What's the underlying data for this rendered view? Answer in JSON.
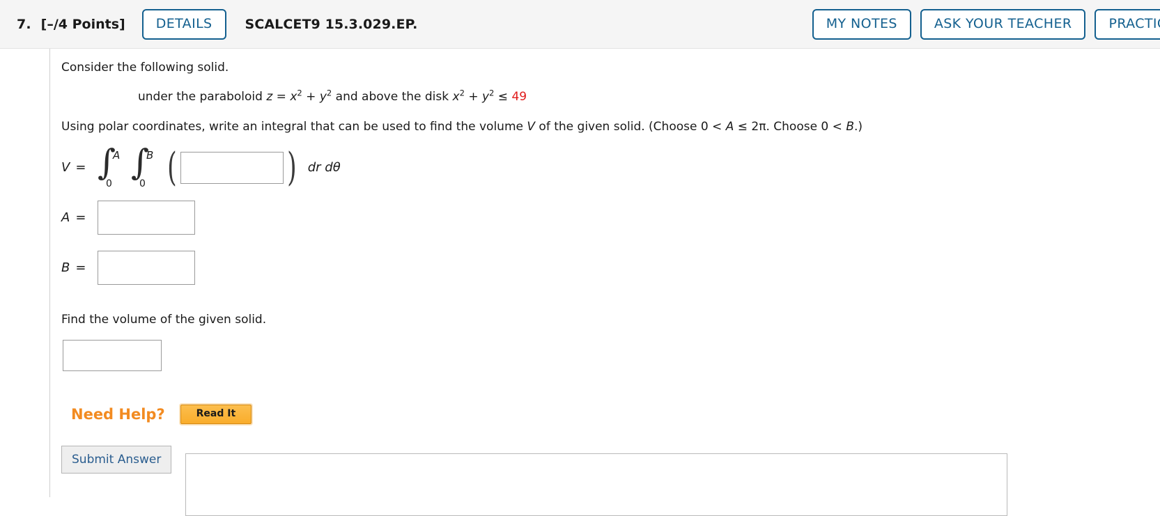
{
  "header": {
    "question_number": "7.",
    "points": "[–/4 Points]",
    "details_label": "DETAILS",
    "assignment_code": "SCALCET9 15.3.029.EP.",
    "my_notes_label": "MY NOTES",
    "ask_teacher_label": "ASK YOUR TEACHER",
    "practice_label": "PRACTICE",
    "accent_color": "#14608f",
    "background_color": "#f5f5f5"
  },
  "problem": {
    "consider_line": "Consider the following solid.",
    "solid_description": {
      "prefix": "under the paraboloid ",
      "z": "z",
      "equals": " = ",
      "x": "x",
      "x_exp": "2",
      "plus1": " + ",
      "y": "y",
      "y_exp": "2",
      "middle": " and above the disk ",
      "x2": "x",
      "x2_exp": "2",
      "plus2": " + ",
      "y2": "y",
      "y2_exp": "2",
      "leq": " ≤ ",
      "radius_value": "49",
      "radius_color": "#e01b1b"
    },
    "instruction": {
      "part1": "Using polar coordinates, write an integral that can be used to find the volume ",
      "V": "V",
      "part2": " of the given solid. (Choose 0 < ",
      "A": "A",
      "part3": " ≤ 2π. Choose 0 < ",
      "B": "B",
      "part4": ".)"
    },
    "find_volume_line": "Find the volume of the given solid."
  },
  "integral_expression": {
    "V_label": "V",
    "equals": "=",
    "outer_upper_limit": "A",
    "outer_lower_limit": "0",
    "inner_upper_limit": "B",
    "inner_lower_limit": "0",
    "integral_symbol": "∫",
    "open_paren": "(",
    "close_paren": ")",
    "differentials": "dr dθ",
    "integrand_value": "",
    "integrand_placeholder": ""
  },
  "fields": {
    "A": {
      "label": "A",
      "equals": "=",
      "value": "",
      "placeholder": ""
    },
    "B": {
      "label": "B",
      "equals": "=",
      "value": "",
      "placeholder": ""
    },
    "volume": {
      "value": "",
      "placeholder": ""
    }
  },
  "help": {
    "need_help_label": "Need Help?",
    "read_it_label": "Read It",
    "label_color": "#f28b21"
  },
  "footer": {
    "submit_label": "Submit Answer"
  }
}
